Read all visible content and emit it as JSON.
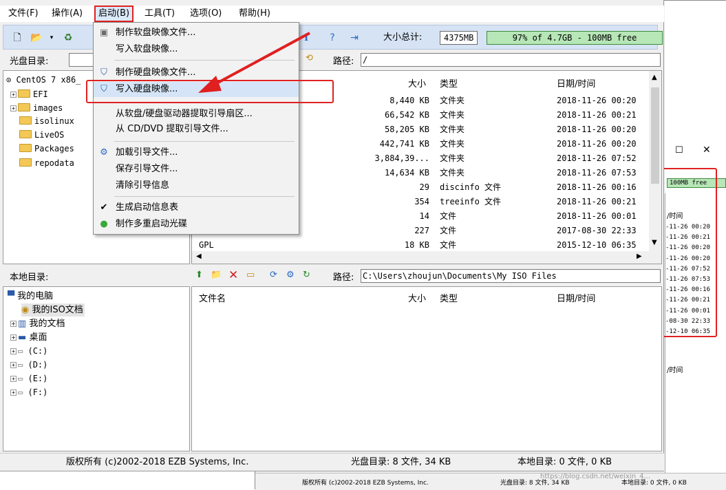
{
  "menubar": {
    "items": [
      "文件(F)",
      "操作(A)",
      "启动(B)",
      "工具(T)",
      "选项(O)",
      "帮助(H)"
    ]
  },
  "toolbar": {
    "size_label": "大小总计:",
    "size_value": "4375MB",
    "capacity_text": "97% of 4.7GB - 100MB free"
  },
  "dropdown": {
    "items": [
      "制作软盘映像文件...",
      "写入软盘映像...",
      "制作硬盘映像文件...",
      "写入硬盘映像...",
      "从软盘/硬盘驱动器提取引导扇区...",
      "从 CD/DVD 提取引导文件...",
      "加载引导文件...",
      "保存引导文件...",
      "清除引导信息",
      "生成启动信息表",
      "制作多重启动光碟"
    ]
  },
  "disc": {
    "label": "光盘目录:",
    "path_label": "路径:",
    "path": "/",
    "tree": [
      {
        "name": "CentOS 7 x86_"
      },
      {
        "name": "EFI"
      },
      {
        "name": "images"
      },
      {
        "name": "isolinux"
      },
      {
        "name": "LiveOS"
      },
      {
        "name": "Packages"
      },
      {
        "name": "repodata"
      }
    ],
    "headers": {
      "size": "大小",
      "type": "类型",
      "date": "日期/时间"
    },
    "files": [
      {
        "size": "8,440 KB",
        "type": "文件夹",
        "date": "2018-11-26 00:20"
      },
      {
        "size": "66,542 KB",
        "type": "文件夹",
        "date": "2018-11-26 00:21"
      },
      {
        "size": "58,205 KB",
        "type": "文件夹",
        "date": "2018-11-26 00:20"
      },
      {
        "size": "442,741 KB",
        "type": "文件夹",
        "date": "2018-11-26 00:20"
      },
      {
        "size": "3,884,39...",
        "type": "文件夹",
        "date": "2018-11-26 07:52"
      },
      {
        "size": "14,634 KB",
        "type": "文件夹",
        "date": "2018-11-26 07:53"
      },
      {
        "size": "29",
        "type": "discinfo 文件",
        "date": "2018-11-26 00:16"
      },
      {
        "size": "354",
        "type": "treeinfo 文件",
        "date": "2018-11-26 00:21"
      },
      {
        "size": "14",
        "type": "文件",
        "date": "2018-11-26 00:01"
      },
      {
        "size": "227",
        "type": "文件",
        "date": "2017-08-30 22:33"
      },
      {
        "name": "GPL",
        "size": "18 KB",
        "type": "文件",
        "date": "2015-12-10 06:35"
      }
    ]
  },
  "local": {
    "label": "本地目录:",
    "path_label": "路径:",
    "path": "C:\\Users\\zhoujun\\Documents\\My ISO Files",
    "tree": [
      {
        "name": "我的电脑"
      },
      {
        "name": "我的ISO文档"
      },
      {
        "name": "我的文档"
      },
      {
        "name": "桌面"
      },
      {
        "name": "(C:)"
      },
      {
        "name": "(D:)"
      },
      {
        "name": "(E:)"
      },
      {
        "name": "(F:)"
      }
    ],
    "headers": {
      "name": "文件名",
      "size": "大小",
      "type": "类型",
      "date": "日期/时间"
    }
  },
  "status": {
    "copyright": "版权所有 (c)2002-2018 EZB Systems, Inc.",
    "disc_summary": "光盘目录: 8 文件, 34 KB",
    "local_summary": "本地目录: 0 文件, 0 KB"
  },
  "background_window": {
    "free_text": "100MB free",
    "col_header": "/时间",
    "col_header2": "/时间",
    "dates": [
      "-11-26 00:20",
      "-11-26 00:21",
      "-11-26 00:20",
      "-11-26 00:20",
      "-11-26 07:52",
      "-11-26 07:53",
      "-11-26 00:16",
      "-11-26 00:21",
      "-11-26 00:01",
      "-08-30 22:33",
      "-12-10 06:35"
    ],
    "status_copyright": "版权所有 (c)2002-2018 EZB Systems, Inc.",
    "status_disc": "光盘目录: 8 文件, 34 KB",
    "status_local": "本地目录: 0 文件, 0 KB"
  },
  "watermark": "https://blog.csdn.net/weixin_4..."
}
